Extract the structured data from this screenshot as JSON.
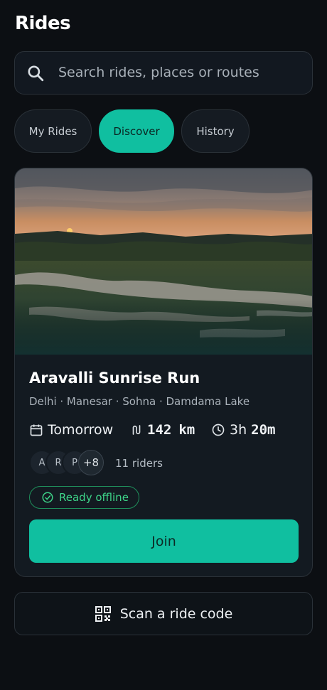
{
  "header": {
    "title": "Rides"
  },
  "search": {
    "placeholder": "Search rides, places or routes",
    "icon": "search-icon"
  },
  "tabs": [
    {
      "label": "My Rides",
      "active": false
    },
    {
      "label": "Discover",
      "active": true
    },
    {
      "label": "History",
      "active": false
    }
  ],
  "ride": {
    "title": "Aravalli Sunrise Run",
    "route": "Delhi · Manesar · Sohna · Damdama Lake",
    "when": "Tomorrow",
    "distance_value": "142",
    "distance_unit": "km",
    "duration_hours": "3h",
    "duration_minutes": "20m",
    "avatars": [
      "A",
      "R",
      "P"
    ],
    "avatars_more": "+8",
    "riders": "11 riders",
    "offline_badge": "Ready offline",
    "join_label": "Join"
  },
  "scan": {
    "label": "Scan a ride code",
    "icon": "qr-code-icon"
  },
  "colors": {
    "accent": "#10bfa0",
    "background": "#0c0f13",
    "card": "#131a21",
    "offline_green": "#3ed68a"
  }
}
